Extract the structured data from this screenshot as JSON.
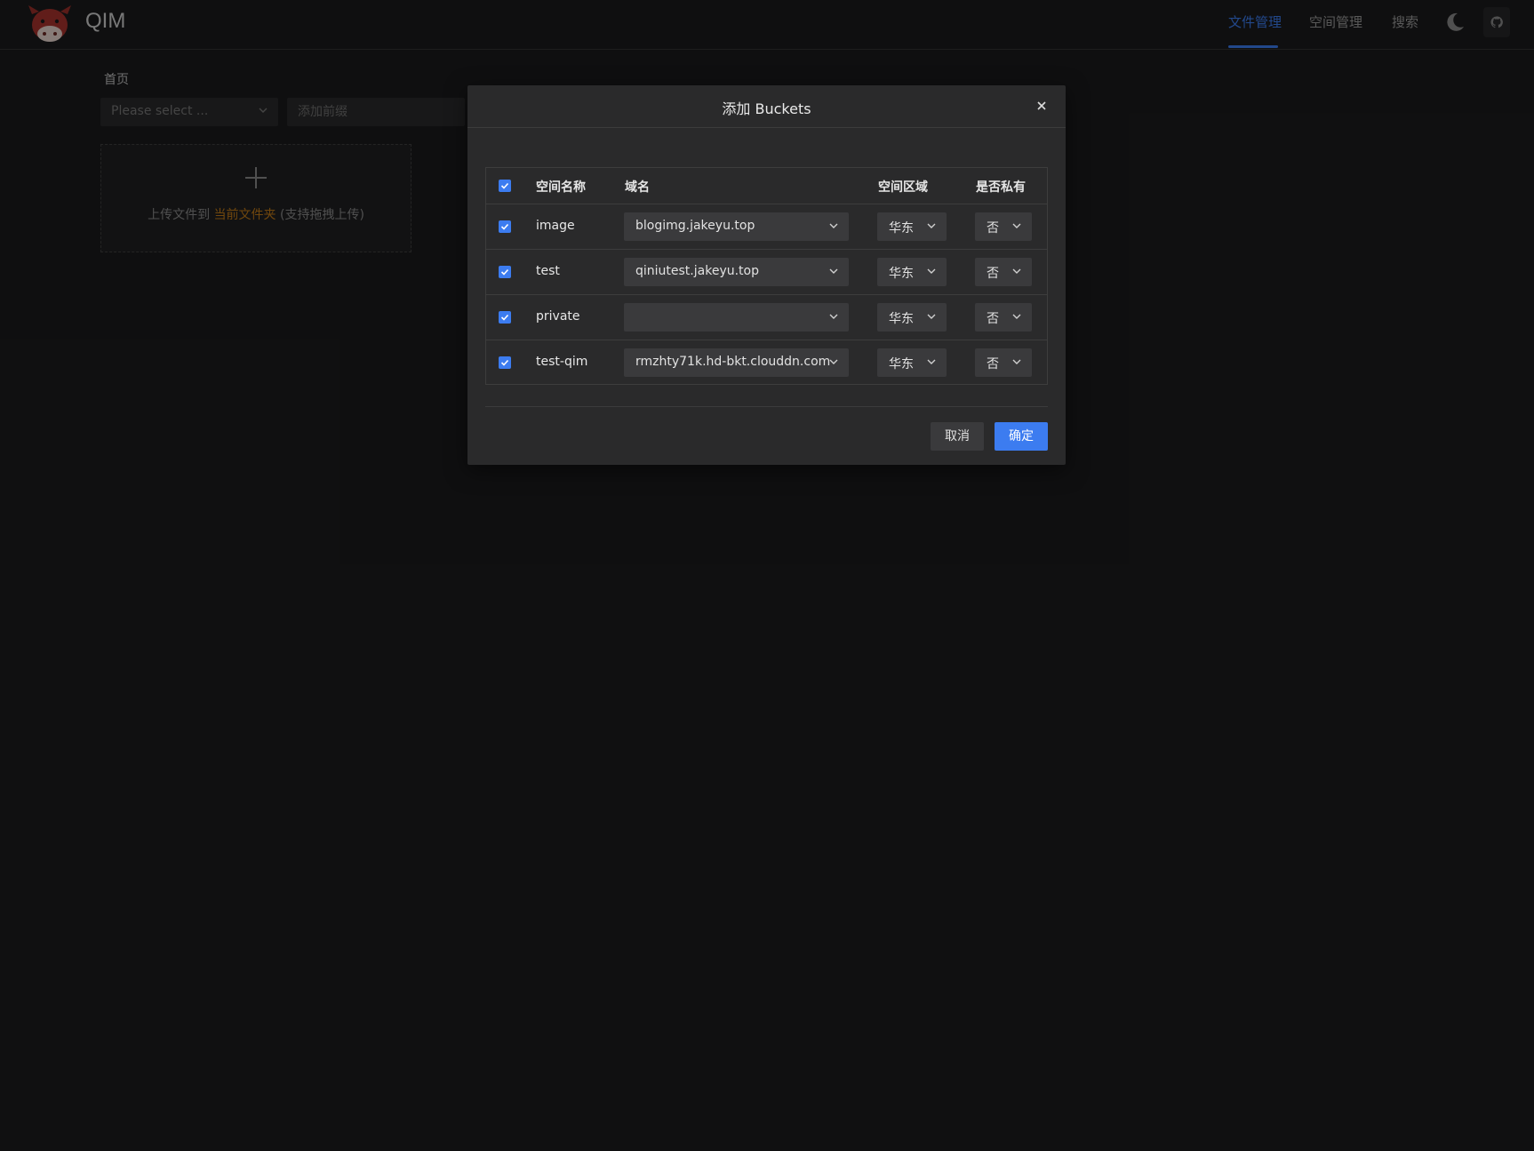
{
  "app": {
    "title": "QIM"
  },
  "nav": {
    "items": [
      {
        "label": "文件管理",
        "active": true
      },
      {
        "label": "空间管理",
        "active": false
      },
      {
        "label": "搜索",
        "active": false
      }
    ]
  },
  "page": {
    "breadcrumb": "首页",
    "bucket_select_placeholder": "Please select ...",
    "prefix_placeholder": "添加前缀",
    "upload": {
      "prefix": "上传文件到",
      "highlight": "当前文件夹",
      "suffix": "(支持拖拽上传)"
    }
  },
  "modal": {
    "title": "添加 Buckets",
    "columns": [
      "空间名称",
      "域名",
      "空间区域",
      "是否私有"
    ],
    "rows": [
      {
        "name": "image",
        "domain": "blogimg.jakeyu.top",
        "region": "华东",
        "private": "否",
        "checked": true
      },
      {
        "name": "test",
        "domain": "qiniutest.jakeyu.top",
        "region": "华东",
        "private": "否",
        "checked": true
      },
      {
        "name": "private",
        "domain": "",
        "region": "华东",
        "private": "否",
        "checked": true
      },
      {
        "name": "test-qim",
        "domain": "rmzhty71k.hd-bkt.clouddn.com",
        "region": "华东",
        "private": "否",
        "checked": true
      }
    ],
    "cancel_label": "取消",
    "ok_label": "确定"
  },
  "colors": {
    "accent": "#3c7cf0",
    "highlight": "#c17a17",
    "background": "#1b1b1d",
    "modal": "#2a2a2b"
  }
}
